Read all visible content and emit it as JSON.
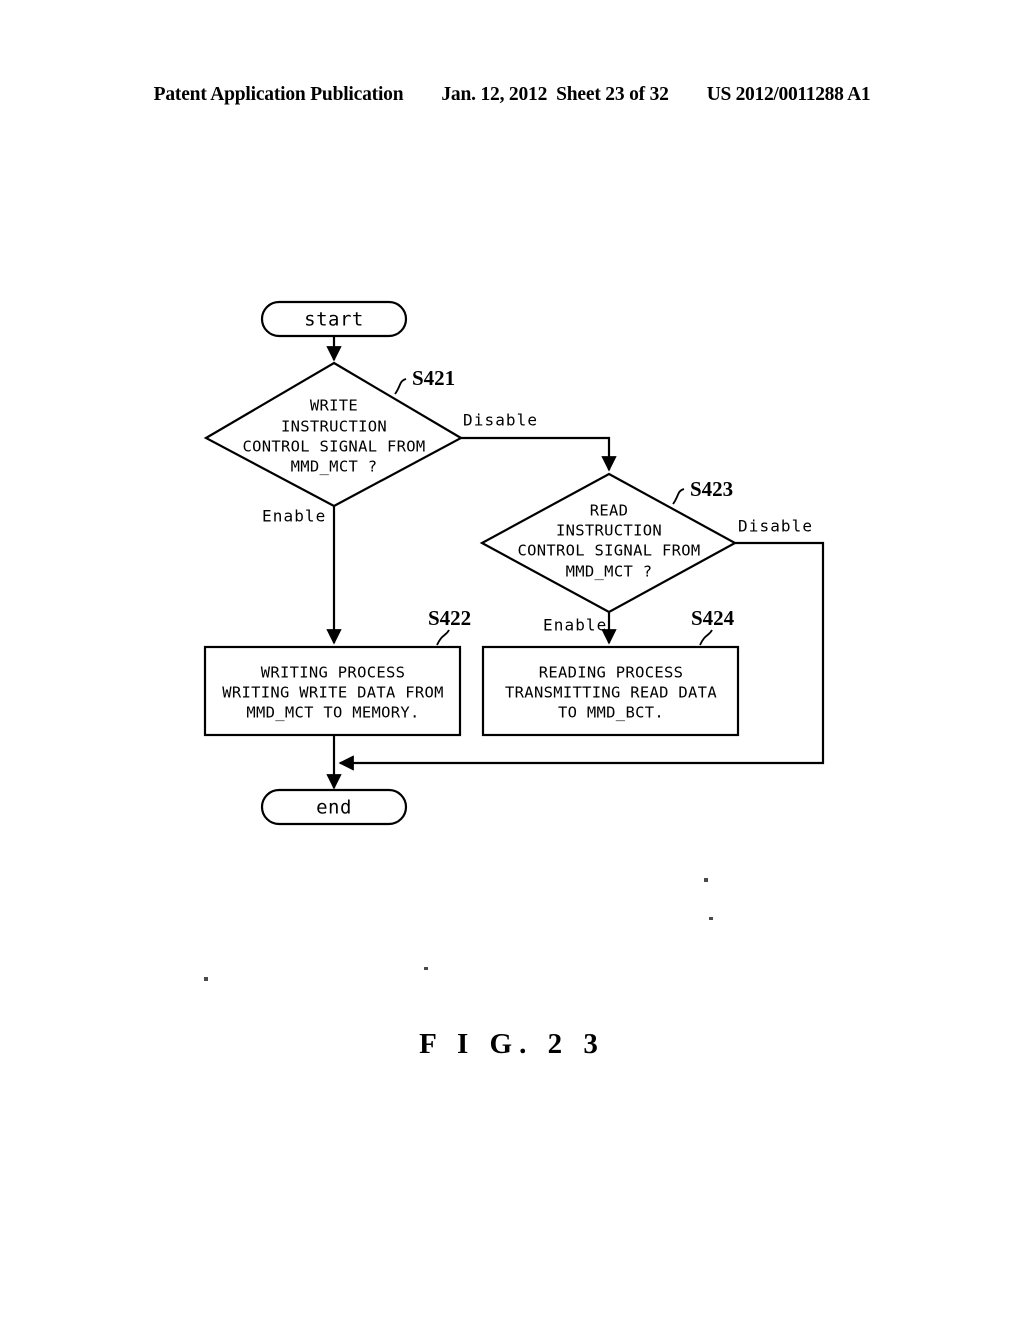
{
  "header": {
    "publication": "Patent Application Publication",
    "date": "Jan. 12, 2012",
    "sheet": "Sheet 23 of 32",
    "number": "US 2012/0011288 A1"
  },
  "figure": {
    "caption": "F I G.  2 3"
  },
  "flowchart": {
    "start": {
      "label": "start"
    },
    "end": {
      "label": "end"
    },
    "decision_s421": {
      "step": "S421",
      "line1": "WRITE",
      "line2": "INSTRUCTION",
      "line3": "CONTROL SIGNAL FROM",
      "line4": "MMD_MCT ?",
      "branch_yes": "Enable",
      "branch_no": "Disable"
    },
    "decision_s423": {
      "step": "S423",
      "line1": "READ",
      "line2": "INSTRUCTION",
      "line3": "CONTROL SIGNAL FROM",
      "line4": "MMD_MCT ?",
      "branch_yes": "Enable",
      "branch_no": "Disable"
    },
    "process_s422": {
      "step": "S422",
      "line1": "WRITING PROCESS",
      "line2": "WRITING WRITE DATA FROM",
      "line3": "MMD_MCT TO MEMORY."
    },
    "process_s424": {
      "step": "S424",
      "line1": "READING PROCESS",
      "line2": "TRANSMITTING READ DATA",
      "line3": "TO MMD_BCT."
    }
  }
}
